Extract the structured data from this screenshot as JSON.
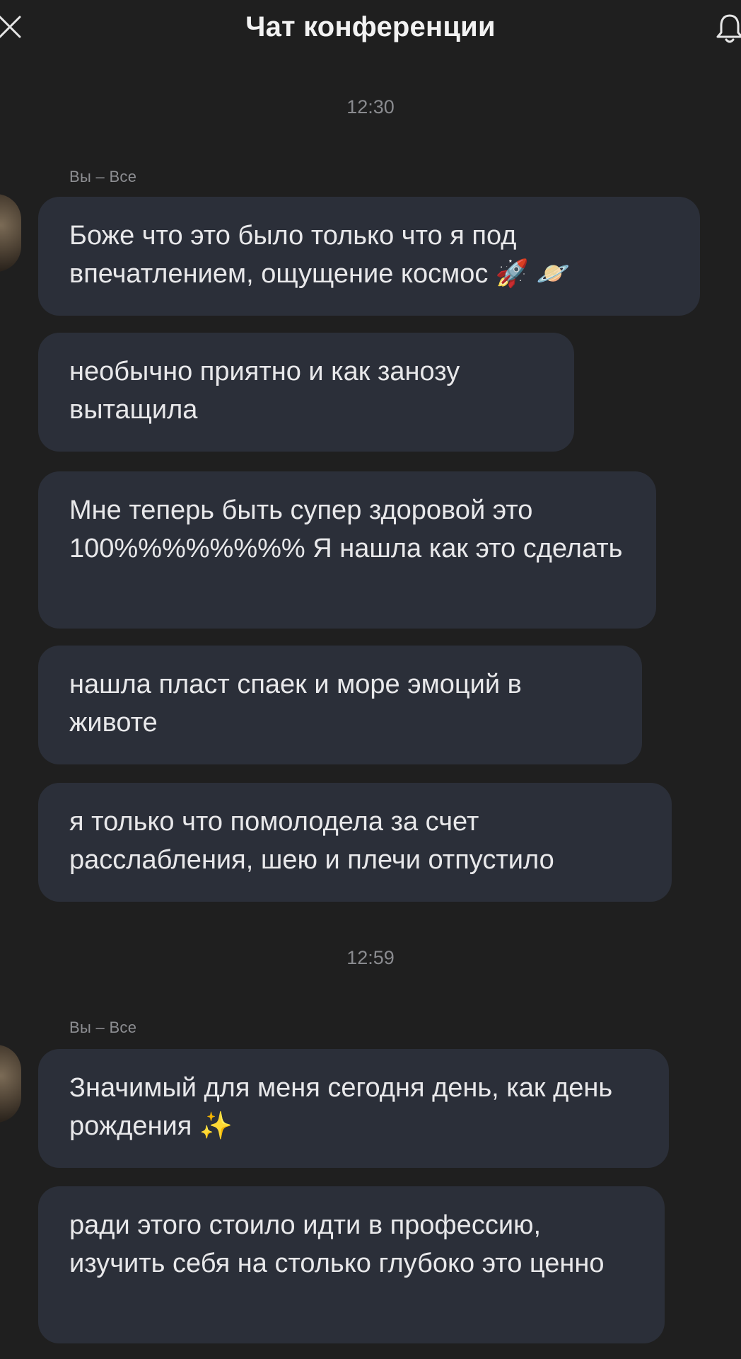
{
  "header": {
    "title": "Чат конференции",
    "close_icon": "close-icon",
    "bell_icon": "bell-icon"
  },
  "groups": [
    {
      "time": "12:30",
      "sender": "Вы – Все",
      "messages": [
        {
          "text": "Боже что это было только что я под впечатлением, ощущение космос 🚀 🪐"
        },
        {
          "text": "необычно приятно и как занозу вытащила"
        },
        {
          "text": "Мне теперь быть супер здоровой это 100%%%%%%%% Я нашла как это сделать"
        },
        {
          "text": "нашла пласт спаек и море эмоций в животе"
        },
        {
          "text": "я только что помолодела за счет расслабления, шею и плечи отпустило"
        }
      ]
    },
    {
      "time": "12:59",
      "sender": "Вы – Все",
      "messages": [
        {
          "text": "Значимый для меня сегодня день, как день рождения ✨"
        },
        {
          "text": "ради этого стоило идти в профессию, изучить себя на столько глубоко это ценно"
        }
      ]
    }
  ],
  "colors": {
    "background": "#1f1f1f",
    "bubble": "#2b2f39",
    "text": "#e8e8ea",
    "muted": "#8a8b8f"
  }
}
